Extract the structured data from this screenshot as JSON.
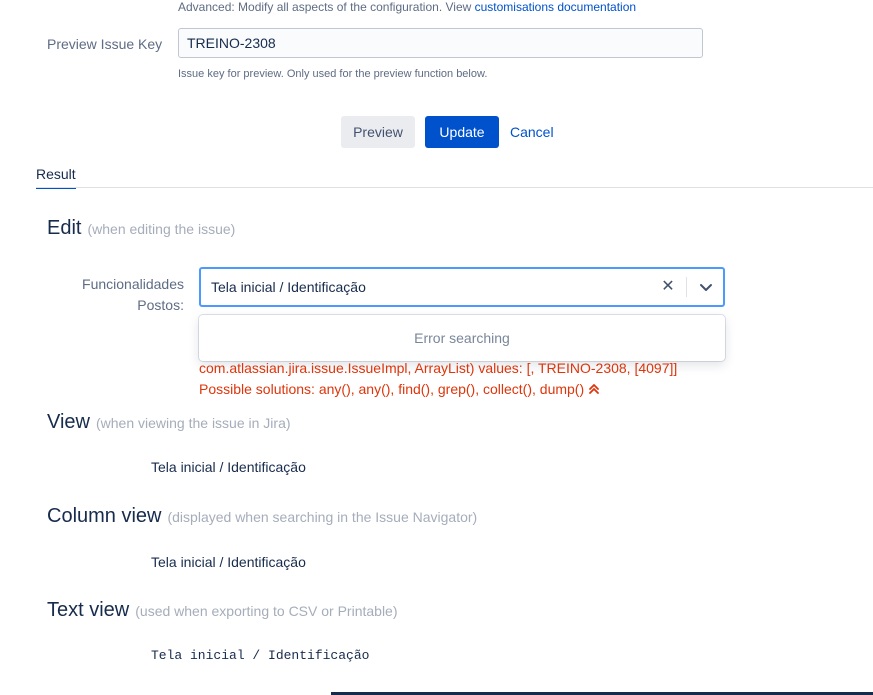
{
  "config": {
    "help_prefix": "Advanced: Modify all aspects of the configuration. View ",
    "help_link": "customisations documentation"
  },
  "preview": {
    "label": "Preview Issue Key",
    "value": "TREINO-2308",
    "help": "Issue key for preview. Only used for the preview function below."
  },
  "buttons": {
    "preview": "Preview",
    "update": "Update",
    "cancel": "Cancel"
  },
  "tabs": {
    "result": "Result"
  },
  "edit": {
    "title": "Edit",
    "subtitle": "(when editing the issue)",
    "field_label_1": "Funcionalidades",
    "field_label_2": "Postos:",
    "selected_value": "Tela inicial / Identificação",
    "dropdown_message": "Error searching",
    "error_line_1": "com.atlassian.jira.issue.IssueImpl, ArrayList) values: [, TREINO-2308, [4097]]",
    "error_line_2": "Possible solutions: any(), any(), find(), grep(), collect(), dump()"
  },
  "view": {
    "title": "View",
    "subtitle": "(when viewing the issue in Jira)",
    "value": "Tela inicial / Identificação"
  },
  "column_view": {
    "title": "Column view",
    "subtitle": "(displayed when searching in the Issue Navigator)",
    "value": "Tela inicial / Identificação"
  },
  "text_view": {
    "title": "Text view",
    "subtitle": "(used when exporting to CSV or Printable)",
    "value": "Tela inicial / Identificação"
  },
  "colors": {
    "primary": "#0052cc",
    "error": "#de350b",
    "focus": "#4c9aff"
  }
}
